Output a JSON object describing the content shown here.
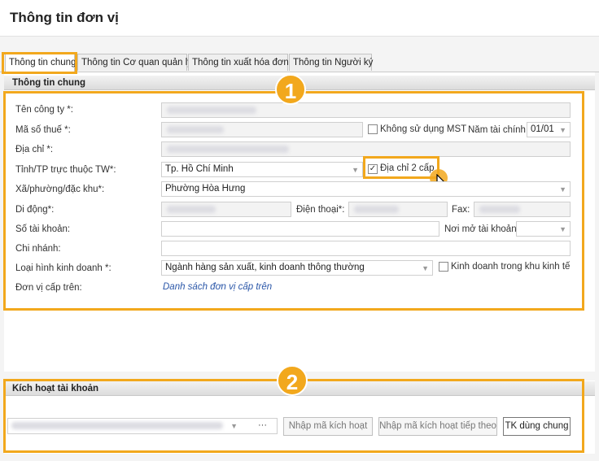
{
  "window": {
    "title": "Thông tin đơn vị"
  },
  "tabs": [
    {
      "label": "Thông tin chung"
    },
    {
      "label": "Thông tin Cơ quan quản lý"
    },
    {
      "label": "Thông tin xuất hóa đơn"
    },
    {
      "label": "Thông tin Người ký"
    }
  ],
  "general": {
    "header": "Thông tin chung",
    "company_name_label": "Tên công ty *:",
    "tax_code_label": "Mã số thuế *:",
    "no_tax_code_label": "Không sử dụng MST",
    "fiscal_year_label": "Năm tài chính:",
    "fiscal_year_value": "01/01",
    "address_label": "Địa chỉ *:",
    "province_label": "Tỉnh/TP trực thuộc TW*:",
    "province_value": "Tp. Hồ Chí Minh",
    "two_level_address_label": "Địa chỉ 2 cấp",
    "two_level_address_checked": true,
    "ward_label": "Xã/phường/đặc khu*:",
    "ward_value": "Phường Hòa Hưng",
    "mobile_label": "Di động*:",
    "phone_label": "Điện thoại*:",
    "fax_label": "Fax:",
    "bank_account_label": "Số tài khoản:",
    "bank_place_label": "Nơi mở tài khoản:",
    "branch_label": "Chi nhánh:",
    "business_type_label": "Loại hình kinh doanh *:",
    "business_type_value": "Ngành hàng sản xuất, kinh doanh thông thường",
    "economic_zone_label": "Kinh doanh trong khu kinh tế",
    "parent_unit_label": "Đơn vị cấp trên:",
    "parent_unit_link": "Danh sách đơn vị cấp trên"
  },
  "activation": {
    "header": "Kích hoạt tài khoản",
    "more_label": "···",
    "enter_code_label": "Nhập mã kích hoạt",
    "enter_code_continue_label": "Nhập mã kích hoạt tiếp theo",
    "shared_account_label": "TK dùng chung"
  },
  "callouts": [
    {
      "number": "1"
    },
    {
      "number": "2"
    }
  ],
  "colors": {
    "highlight": "#f2a81d",
    "link": "#2a56a8"
  }
}
